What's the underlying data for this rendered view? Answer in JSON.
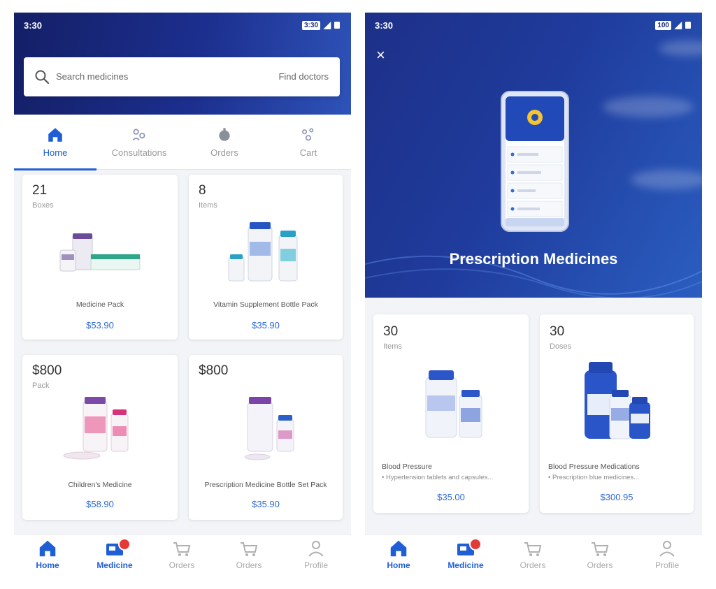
{
  "left": {
    "status": {
      "time": "3:30",
      "battery": "3:30"
    },
    "search": {
      "placeholder": "Search medicines",
      "right_label": "Find doctors"
    },
    "tabs": [
      {
        "label": "Home",
        "icon": "home-icon"
      },
      {
        "label": "Consultations",
        "icon": "consultation-icon"
      },
      {
        "label": "Orders",
        "icon": "orders-icon"
      },
      {
        "label": "Cart",
        "icon": "cart-icon"
      }
    ],
    "cards": [
      {
        "count": "21",
        "unit": "Boxes",
        "name": "Medicine Pack",
        "price": "$53.90"
      },
      {
        "count": "8",
        "unit": "Items",
        "name": "Vitamin Supplement Bottle Pack",
        "price": "$35.90"
      },
      {
        "count": "$800",
        "unit": "Pack",
        "name": "Children's Medicine",
        "price": "$58.90"
      },
      {
        "count": "$800",
        "unit": "",
        "name": "Prescription Medicine Bottle Set Pack",
        "price": "$35.90"
      }
    ]
  },
  "right": {
    "status": {
      "time": "3:30",
      "battery": "100"
    },
    "hero": {
      "title": "Prescription Medicines",
      "close": "×"
    },
    "cards": [
      {
        "count": "30",
        "unit": "Items",
        "name": "Blood Pressure",
        "sub": "• Hypertension tablets and capsules...",
        "price": "$35.00"
      },
      {
        "count": "30",
        "unit": "Doses",
        "name": "Blood Pressure Medications",
        "sub": "• Prescription blue medicines...",
        "price": "$300.95"
      }
    ]
  },
  "bottom_nav": [
    {
      "label": "Home",
      "icon": "home-icon"
    },
    {
      "label": "Medicine",
      "icon": "medicine-icon"
    },
    {
      "label": "Orders",
      "icon": "cart-icon"
    },
    {
      "label": "Orders",
      "icon": "cart-icon"
    },
    {
      "label": "Profile",
      "icon": "profile-icon"
    }
  ],
  "colors": {
    "accent": "#1f5fd6",
    "header": "#1c2f8f",
    "badge": "#e53935"
  }
}
